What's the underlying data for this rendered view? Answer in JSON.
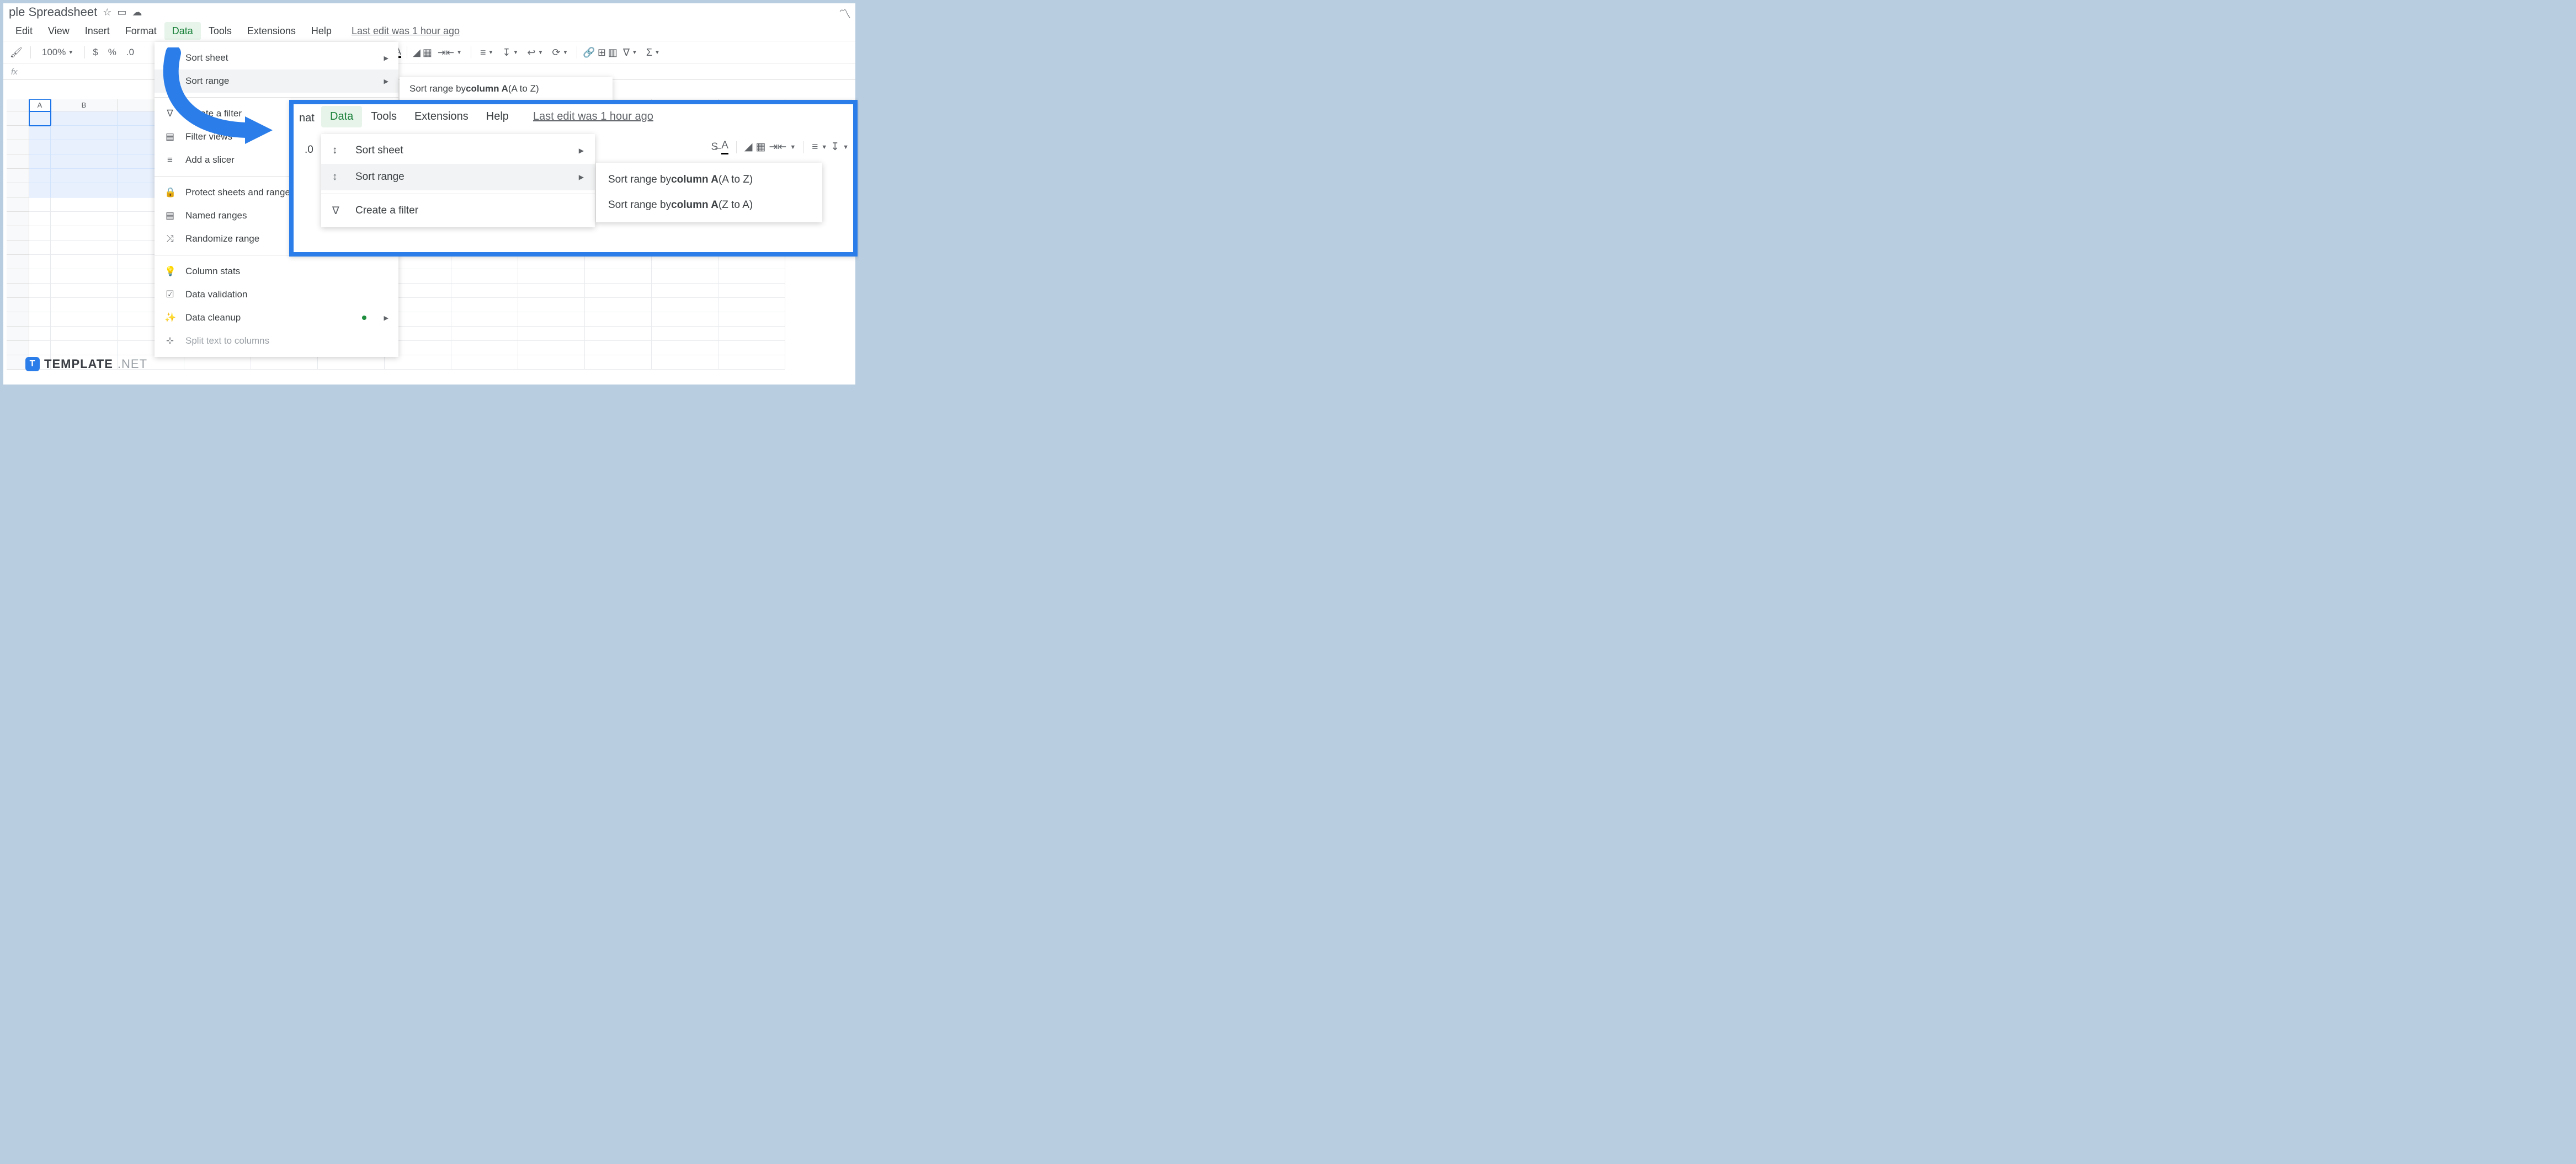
{
  "doc_title": "ple Spreadsheet",
  "menubar": [
    "Edit",
    "View",
    "Insert",
    "Format",
    "Data",
    "Tools",
    "Extensions",
    "Help"
  ],
  "menubar_active": "Data",
  "last_edit": "Last edit was 1 hour ago",
  "toolbar": {
    "zoom": "100%",
    "currency": "$",
    "percent": "%",
    "decimals": ".0"
  },
  "columns": [
    "A",
    "B"
  ],
  "dropdown": {
    "sort_sheet": "Sort sheet",
    "sort_range": "Sort range",
    "create_filter": "Create a filter",
    "filter_views": "Filter views",
    "add_slicer": "Add a slicer",
    "protect": "Protect sheets and ranges",
    "named_ranges": "Named ranges",
    "randomize": "Randomize range",
    "column_stats": "Column stats",
    "data_validation": "Data validation",
    "data_cleanup": "Data cleanup",
    "split_text": "Split text to columns"
  },
  "submenu_bg": {
    "prefix": "Sort range by ",
    "bold": "column A",
    "suffix": " (A to Z)"
  },
  "callout": {
    "nat_fragment": "nat",
    "zero_fragment": ".0",
    "menubar": [
      "Data",
      "Tools",
      "Extensions",
      "Help"
    ],
    "menubar_active": "Data",
    "last_edit": "Last edit was 1 hour ago",
    "dd2": {
      "sort_sheet": "Sort sheet",
      "sort_range": "Sort range",
      "create_filter": "Create a filter"
    },
    "dd3": [
      {
        "prefix": "Sort range by ",
        "bold": "column A",
        "suffix": " (A to Z)"
      },
      {
        "prefix": "Sort range by ",
        "bold": "column A",
        "suffix": " (Z to A)"
      }
    ]
  },
  "watermark": {
    "brand": "TEMPLATE",
    "tld": ".NET",
    "logo": "T"
  }
}
